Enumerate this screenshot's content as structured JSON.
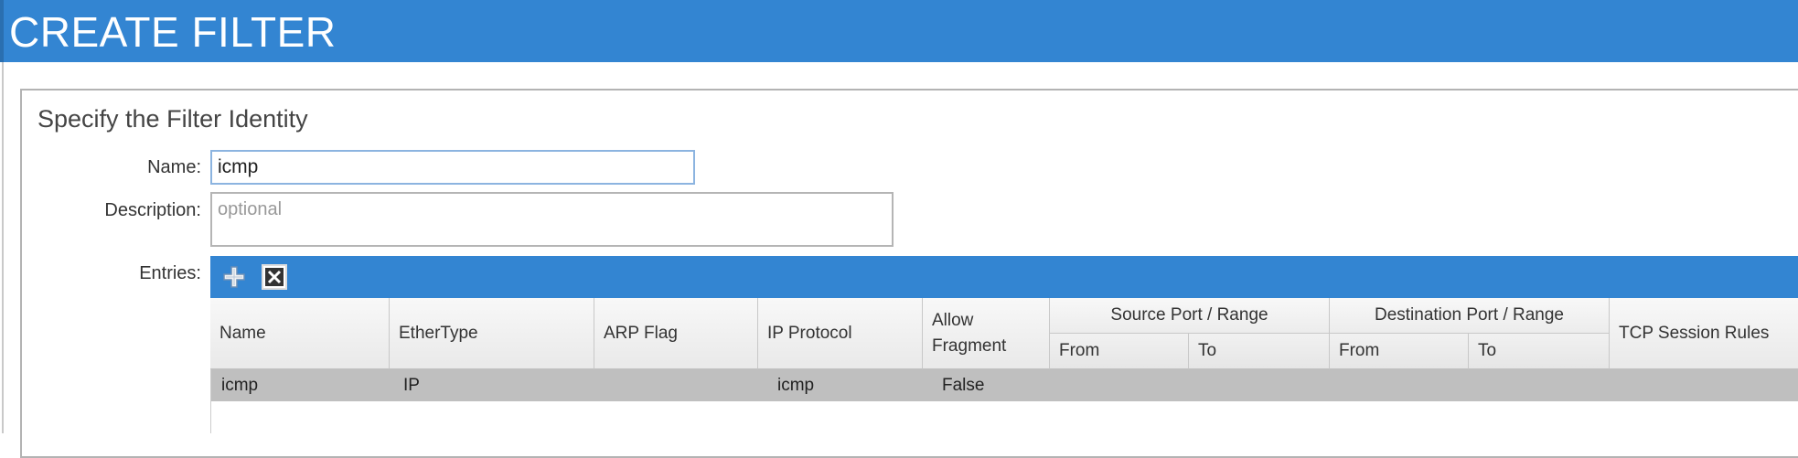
{
  "window": {
    "title": "CREATE FILTER"
  },
  "form": {
    "section_title": "Specify the Filter Identity",
    "name_label": "Name:",
    "name_value": "icmp",
    "description_label": "Description:",
    "description_placeholder": "optional",
    "entries_label": "Entries:"
  },
  "toolbar": {
    "add_icon": "plus-icon",
    "delete_icon": "close-box-icon"
  },
  "table": {
    "headers": {
      "name": "Name",
      "ethertype": "EtherType",
      "arp_flag": "ARP Flag",
      "ip_protocol": "IP Protocol",
      "allow_fragment": "Allow Fragment",
      "source_port_range": "Source Port / Range",
      "destination_port_range": "Destination Port / Range",
      "from": "From",
      "to": "To",
      "tcp_session_rules": "TCP Session Rules"
    },
    "rows": [
      {
        "name": "icmp",
        "ethertype": "IP",
        "arp_flag": "",
        "ip_protocol": "icmp",
        "allow_fragment": "False",
        "src_from": "",
        "src_to": "",
        "dst_from": "",
        "dst_to": "",
        "tcp_session_rules": ""
      }
    ]
  },
  "colors": {
    "accent": "#3385d2",
    "selected_row": "#bfbfbf"
  }
}
